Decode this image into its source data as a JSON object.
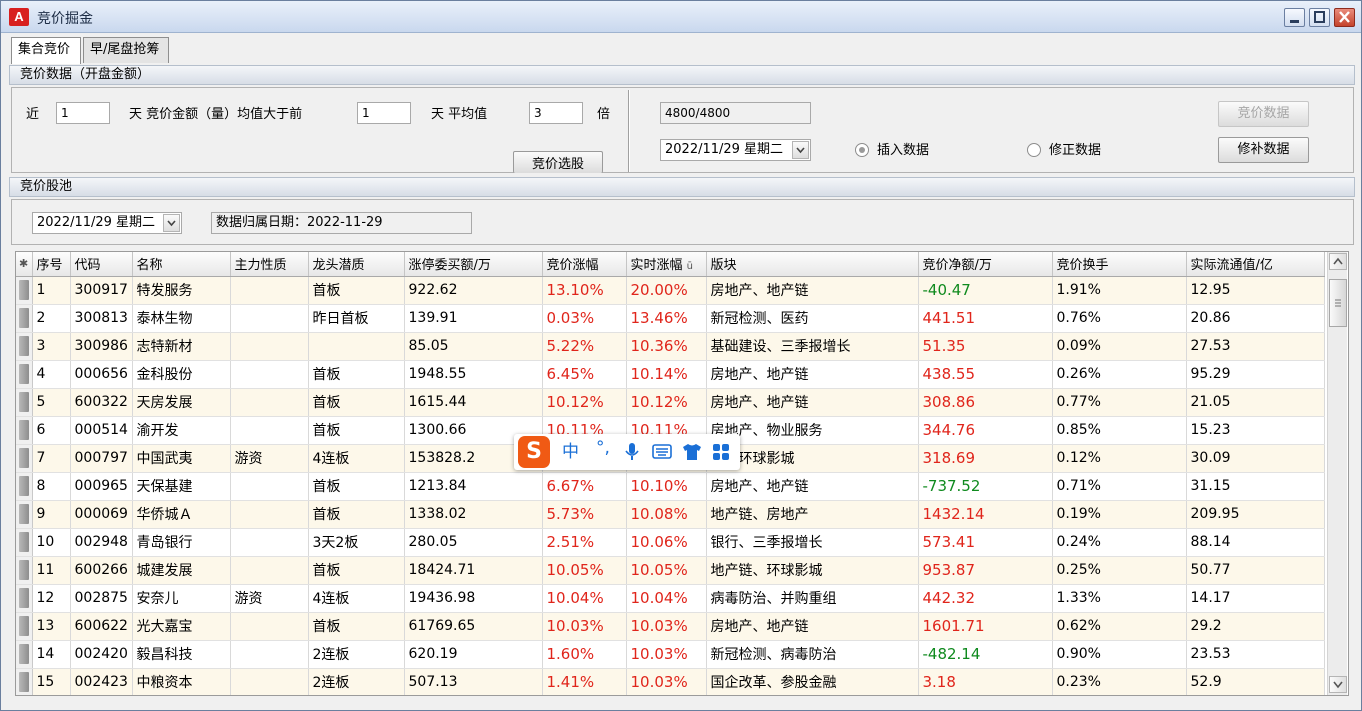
{
  "window": {
    "title": "竞价掘金",
    "app_icon_text": "A"
  },
  "tabs": [
    {
      "label": "集合竞价",
      "active": true
    },
    {
      "label": "早/尾盘抢筹",
      "active": false
    }
  ],
  "section1": {
    "header": "竞价数据（开盘金额）",
    "near_label": "近",
    "near_value": "1",
    "days_label1": "天  竞价金额（量）均值大于前",
    "prev_value": "1",
    "days_label2": "天  平均值",
    "times_value": "3",
    "times_label": "倍",
    "select_button": "竞价选股",
    "progress_value": "4800/4800",
    "date_value": "2022/11/29 星期二",
    "radio_insert": "插入数据",
    "radio_fix": "修正数据",
    "bid_data_button": "竞价数据",
    "patch_button": "修补数据"
  },
  "section2": {
    "header": "竞价股池",
    "date_value": "2022/11/29 星期二",
    "belong_date": "数据归属日期：2022-11-29"
  },
  "table": {
    "corner": "✱",
    "columns": [
      "序号",
      "代码",
      "名称",
      "主力性质",
      "龙头潜质",
      "涨停委买额/万",
      "竞价涨幅",
      "实时涨幅",
      "版块",
      "竞价净额/万",
      "竞价换手",
      "实际流通值/亿"
    ],
    "sort_marker": "ū",
    "rows": [
      [
        "1",
        "300917",
        "特发服务",
        "",
        "首板",
        "922.62",
        "13.10%",
        "20.00%",
        "房地产、地产链",
        "-40.47",
        "1.91%",
        "12.95"
      ],
      [
        "2",
        "300813",
        "泰林生物",
        "",
        "昨日首板",
        "139.91",
        "0.03%",
        "13.46%",
        "新冠检测、医药",
        "441.51",
        "0.76%",
        "20.86"
      ],
      [
        "3",
        "300986",
        "志特新材",
        "",
        "",
        "85.05",
        "5.22%",
        "10.36%",
        "基础建设、三季报增长",
        "51.35",
        "0.09%",
        "27.53"
      ],
      [
        "4",
        "000656",
        "金科股份",
        "",
        "首板",
        "1948.55",
        "6.45%",
        "10.14%",
        "房地产、地产链",
        "438.55",
        "0.26%",
        "95.29"
      ],
      [
        "5",
        "600322",
        "天房发展",
        "",
        "首板",
        "1615.44",
        "10.12%",
        "10.12%",
        "房地产、地产链",
        "308.86",
        "0.77%",
        "21.05"
      ],
      [
        "6",
        "000514",
        "渝开发",
        "",
        "首板",
        "1300.66",
        "10.11%",
        "10.11%",
        "房地产、物业服务",
        "344.76",
        "0.85%",
        "15.23"
      ],
      [
        "7",
        "000797",
        "中国武夷",
        "游资",
        "4连板",
        "153828.2",
        "",
        "",
        "产、环球影城",
        "318.69",
        "0.12%",
        "30.09"
      ],
      [
        "8",
        "000965",
        "天保基建",
        "",
        "首板",
        "1213.84",
        "6.67%",
        "10.10%",
        "房地产、地产链",
        "-737.52",
        "0.71%",
        "31.15"
      ],
      [
        "9",
        "000069",
        "华侨城Ａ",
        "",
        "首板",
        "1338.02",
        "5.73%",
        "10.08%",
        "地产链、房地产",
        "1432.14",
        "0.19%",
        "209.95"
      ],
      [
        "10",
        "002948",
        "青岛银行",
        "",
        "3天2板",
        "280.05",
        "2.51%",
        "10.06%",
        "银行、三季报增长",
        "573.41",
        "0.24%",
        "88.14"
      ],
      [
        "11",
        "600266",
        "城建发展",
        "",
        "首板",
        "18424.71",
        "10.05%",
        "10.05%",
        "地产链、环球影城",
        "953.87",
        "0.25%",
        "50.77"
      ],
      [
        "12",
        "002875",
        "安奈儿",
        "游资",
        "4连板",
        "19436.98",
        "10.04%",
        "10.04%",
        "病毒防治、并购重组",
        "442.32",
        "1.33%",
        "14.17"
      ],
      [
        "13",
        "600622",
        "光大嘉宝",
        "",
        "首板",
        "61769.65",
        "10.03%",
        "10.03%",
        "房地产、地产链",
        "1601.71",
        "0.62%",
        "29.2"
      ],
      [
        "14",
        "002420",
        "毅昌科技",
        "",
        "2连板",
        "620.19",
        "1.60%",
        "10.03%",
        "新冠检测、病毒防治",
        "-482.14",
        "0.90%",
        "23.53"
      ],
      [
        "15",
        "002423",
        "中粮资本",
        "",
        "2连板",
        "507.13",
        "1.41%",
        "10.03%",
        "国企改革、参股金融",
        "3.18",
        "0.23%",
        "52.9"
      ]
    ]
  },
  "ime": {
    "logo": "S",
    "lang": "中",
    "punct": "°,"
  }
}
